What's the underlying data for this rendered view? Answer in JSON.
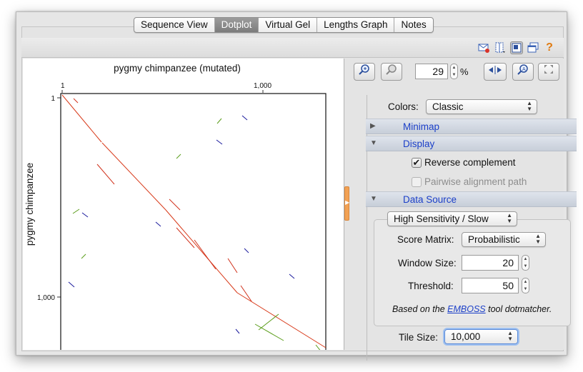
{
  "tabs": [
    {
      "label": "Sequence View",
      "active": false
    },
    {
      "label": "Dotplot",
      "active": true
    },
    {
      "label": "Virtual Gel",
      "active": false
    },
    {
      "label": "Lengths Graph",
      "active": false
    },
    {
      "label": "Notes",
      "active": false
    }
  ],
  "toolbar": {
    "icons": [
      "email-icon",
      "split-view-icon",
      "layout-icon",
      "new-window-icon",
      "help-icon"
    ],
    "help_glyph": "?"
  },
  "plot": {
    "x_label": "pygmy chimpanzee (mutated)",
    "y_label": "pygmy chimpanzee",
    "x_ticks": [
      "1",
      "1,000"
    ],
    "y_ticks": [
      "1",
      "1,000"
    ]
  },
  "controls": {
    "zoom_value": "29",
    "zoom_unit": "%"
  },
  "colors_row": {
    "label": "Colors:",
    "value": "Classic"
  },
  "sections": {
    "minimap": "Minimap",
    "display": "Display",
    "data_source": "Data Source"
  },
  "display": {
    "reverse_complement_label": "Reverse complement",
    "reverse_complement_checked": true,
    "pairwise_label": "Pairwise alignment path",
    "pairwise_checked": false
  },
  "data_source": {
    "algorithm": "High Sensitivity / Slow",
    "score_matrix_label": "Score Matrix:",
    "score_matrix_value": "Probabilistic",
    "window_size_label": "Window Size:",
    "window_size_value": "20",
    "threshold_label": "Threshold:",
    "threshold_value": "50",
    "note_prefix": "Based on the ",
    "note_link": "EMBOSS",
    "note_suffix": " tool dotmatcher."
  },
  "tile_size": {
    "label": "Tile Size:",
    "value": "10,000"
  },
  "colors": {
    "diagonal": "#d83a1a",
    "forward": "#d0301a",
    "reverse": "#1a1a9c",
    "mixed": "#5a9c1a",
    "accent": "#1b3fc8"
  }
}
